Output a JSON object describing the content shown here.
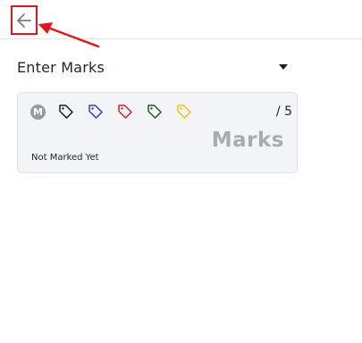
{
  "header": {
    "back_icon": "arrow-left-icon",
    "annotation_color": "#e0161c"
  },
  "section": {
    "title": "Enter Marks",
    "caret_icon": "caret-down-icon"
  },
  "card": {
    "badge_letter": "M",
    "tags": [
      {
        "name": "black-tag-icon",
        "color": "#1a1a1a"
      },
      {
        "name": "blue-tag-icon",
        "color": "#2e44b0"
      },
      {
        "name": "red-tag-icon",
        "color": "#c42b2b"
      },
      {
        "name": "green-tag-icon",
        "color": "#1e5e1e"
      },
      {
        "name": "yellow-tag-icon",
        "color": "#f0c419"
      }
    ],
    "score": "/ 5",
    "marks_label": "Marks",
    "status": "Not Marked Yet"
  }
}
